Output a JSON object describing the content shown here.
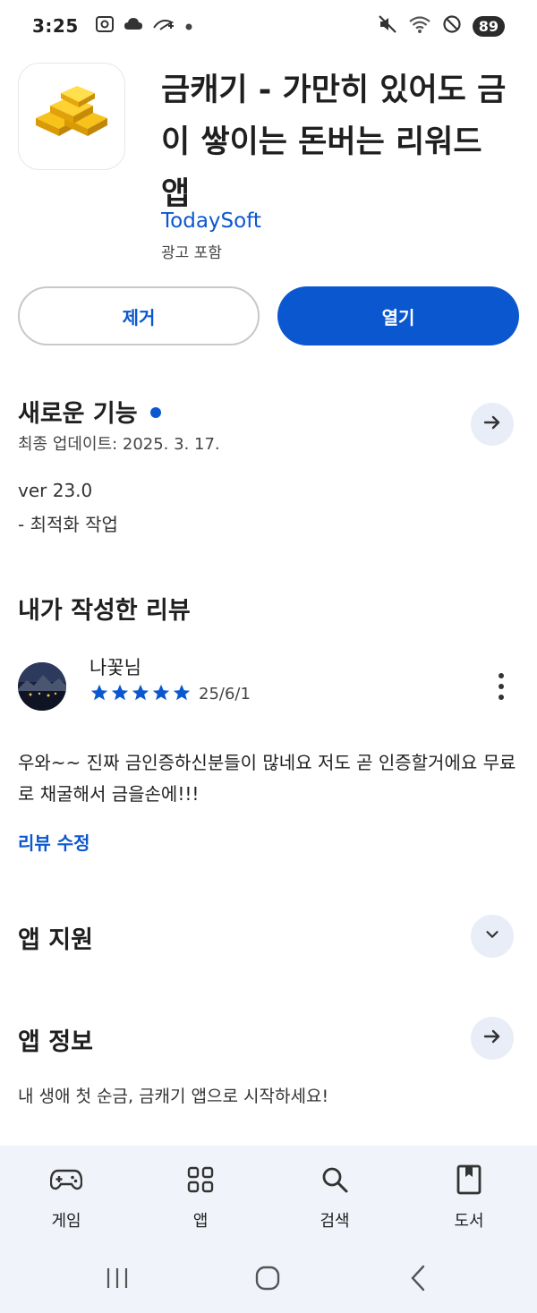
{
  "status_bar": {
    "time": "3:25",
    "battery": "89",
    "icons": [
      "screenshot-icon",
      "cloud-icon",
      "disney-plus-icon",
      "dot-icon",
      "mute-icon",
      "wifi-icon",
      "do-not-disturb-icon"
    ]
  },
  "app": {
    "title": "금캐기 - 가만히 있어도 금이 쌓이는 돈버는 리워드 앱",
    "developer": "TodaySoft",
    "ads_note": "광고 포함",
    "icon": "gold-bars-icon"
  },
  "actions": {
    "remove_label": "제거",
    "open_label": "열기"
  },
  "whats_new": {
    "title": "새로운 기능",
    "last_updated": "최종 업데이트: 2025. 3. 17.",
    "version": "ver 23.0",
    "notes": "- 최적화 작업"
  },
  "my_review": {
    "section_title": "내가 작성한 리뷰",
    "reviewer": "나꽃님",
    "rating": 5,
    "date": "25/6/1",
    "text": "우와~~ 진짜 금인증하신분들이 많네요 저도 곧 인증할거에요 무료로 채굴해서 금을손에!!!",
    "edit_label": "리뷰 수정"
  },
  "app_support": {
    "title": "앱 지원"
  },
  "app_info": {
    "title": "앱 정보",
    "description": "내 생애 첫 순금, 금캐기 앱으로 시작하세요!"
  },
  "bottom_nav": {
    "items": [
      {
        "label": "게임",
        "icon": "gamepad-icon"
      },
      {
        "label": "앱",
        "icon": "apps-grid-icon"
      },
      {
        "label": "검색",
        "icon": "search-icon"
      },
      {
        "label": "도서",
        "icon": "book-icon"
      }
    ]
  },
  "colors": {
    "accent": "#0b57d0",
    "nav_background": "#f0f3f9",
    "round_button": "#e9edf7"
  }
}
